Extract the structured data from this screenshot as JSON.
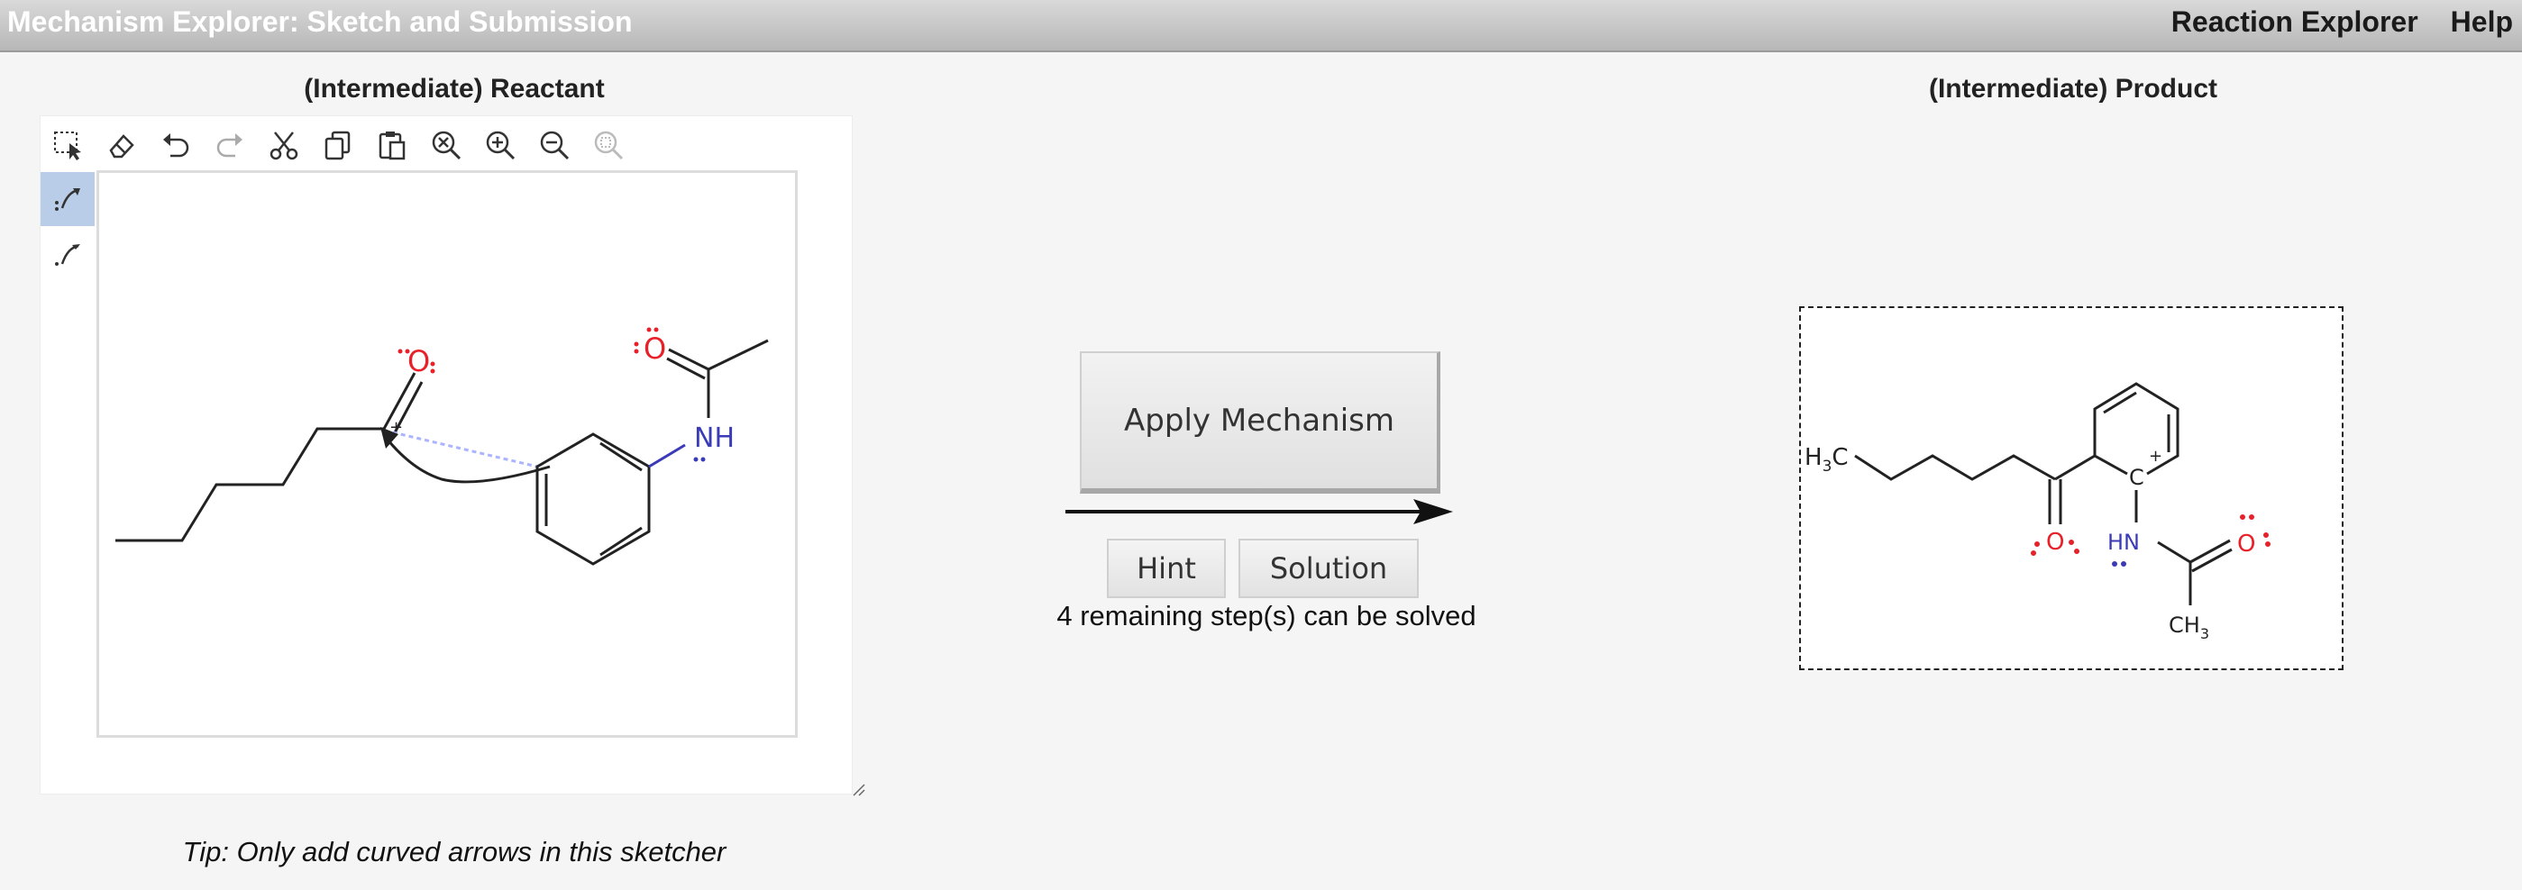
{
  "app": {
    "title": "Mechanism Explorer: Sketch and Submission",
    "nav": [
      "Reaction Explorer",
      "Help"
    ]
  },
  "reactant": {
    "title": "(Intermediate) Reactant",
    "toolbar": [
      "select-icon",
      "eraser-icon",
      "undo-icon",
      "redo-icon",
      "cut-icon",
      "copy-icon",
      "paste-icon",
      "zoom-reset-icon",
      "zoom-in-icon",
      "zoom-out-icon",
      "zoom-fit-icon"
    ],
    "side_tools": [
      "electron-pair-arrow-icon",
      "single-electron-arrow-icon"
    ],
    "molecule_labels": {
      "oxygen_ketone": "O",
      "plus": "+",
      "oxygen_amide": "O",
      "nh": "NH"
    },
    "tip": "Tip: Only add curved arrows in this sketcher"
  },
  "controls": {
    "apply_label": "Apply Mechanism",
    "hint_label": "Hint",
    "solution_label": "Solution",
    "remaining": "4 remaining step(s) can be solved"
  },
  "product": {
    "title": "(Intermediate) Product",
    "labels": {
      "h3c": "H",
      "h3c_sub": "3",
      "h3c_c": "C",
      "o_ketone": "O",
      "c_plus": "C",
      "plus": "+",
      "hn": "HN",
      "o_amide": "O",
      "ch3": "CH",
      "ch3_sub": "3"
    }
  },
  "colors": {
    "oxygen": "#e8202a",
    "nitrogen": "#3b3bb8",
    "bond": "#222222",
    "selected_tool": "#b9cde9"
  }
}
